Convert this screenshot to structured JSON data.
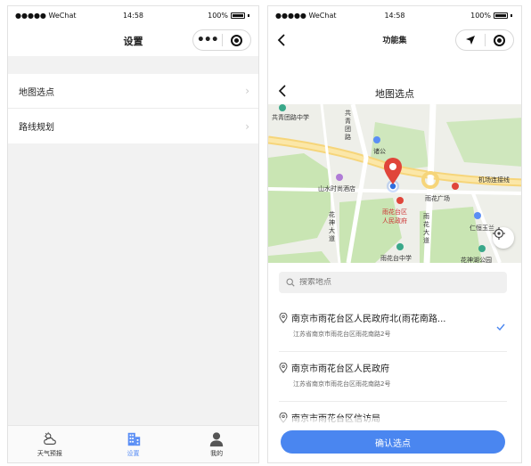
{
  "left": {
    "status": {
      "carrier": "●●●●● WeChat",
      "time": "14:58",
      "battery": "100%"
    },
    "nav": {
      "title": "设置"
    },
    "menu": [
      {
        "label": "地图选点"
      },
      {
        "label": "路线规划"
      }
    ],
    "tabs": [
      {
        "label": "天气预报",
        "icon": "weather-icon"
      },
      {
        "label": "设置",
        "icon": "building-icon"
      },
      {
        "label": "我的",
        "icon": "user-icon"
      }
    ]
  },
  "right": {
    "status": {
      "carrier": "●●●●● WeChat",
      "time": "14:58",
      "battery": "100%"
    },
    "nav": {
      "title": "功能集"
    },
    "sub": {
      "title": "地图选点"
    },
    "map": {
      "labels": {
        "school1": "共青团路中学",
        "road1": "共青团路",
        "zhuge": "诸公",
        "hotel": "山水时尚酒店",
        "gov": "雨花台区人民政府",
        "gov1": "雨花台区",
        "gov2": "人民政府",
        "plaza": "雨花广场",
        "airport": "机场连接线",
        "road2": "花神大道",
        "road3": "雨花大道",
        "renheng": "仁恒玉兰",
        "school2": "雨花台中学",
        "park": "花神湖公园"
      }
    },
    "search": {
      "placeholder": "搜索地点"
    },
    "places": [
      {
        "name": "南京市雨花台区人民政府北(雨花南路...",
        "addr": "江苏省南京市雨花台区雨花南路2号",
        "selected": true
      },
      {
        "name": "南京市雨花台区人民政府",
        "addr": "江苏省南京市雨花台区雨花南路2号",
        "selected": false
      },
      {
        "name": "南京市雨花台区信访局",
        "addr": "",
        "selected": false
      }
    ],
    "confirm_label": "确认选点"
  },
  "colors": {
    "accent": "#4a86f0",
    "pin": "#e0453a"
  }
}
